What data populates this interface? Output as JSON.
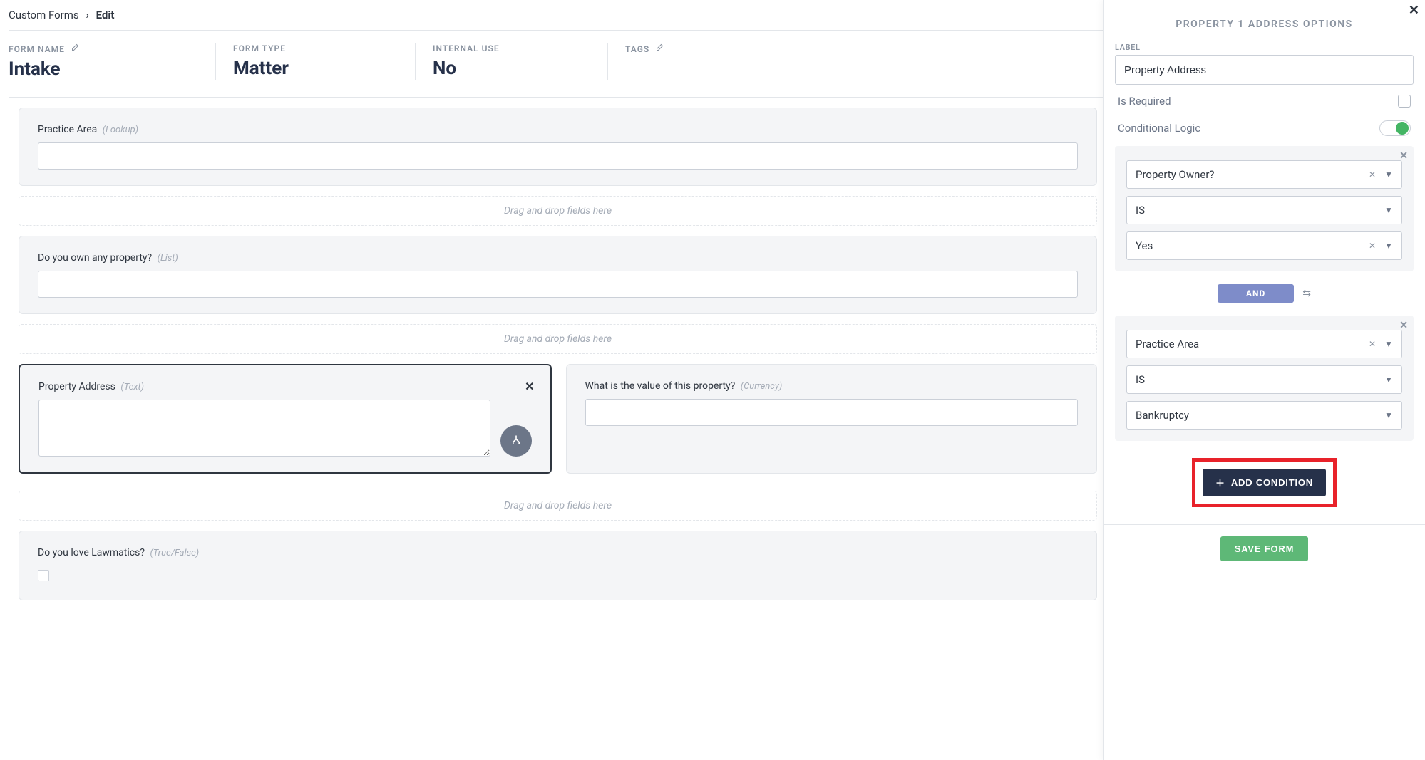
{
  "breadcrumb": {
    "root": "Custom Forms",
    "current": "Edit"
  },
  "meta": {
    "formName": {
      "label": "FORM NAME",
      "value": "Intake"
    },
    "formType": {
      "label": "FORM TYPE",
      "value": "Matter"
    },
    "internal": {
      "label": "INTERNAL USE",
      "value": "No"
    },
    "tags": {
      "label": "TAGS"
    }
  },
  "dropText": "Drag and drop fields here",
  "fields": {
    "practiceArea": {
      "label": "Practice Area",
      "hint": "(Lookup)"
    },
    "ownProperty": {
      "label": "Do you own any property?",
      "hint": "(List)"
    },
    "propertyAddress": {
      "label": "Property Address",
      "hint": "(Text)"
    },
    "propertyValue": {
      "label": "What is the value of this property?",
      "hint": "(Currency)"
    },
    "loveLawmatics": {
      "label": "Do you love Lawmatics?",
      "hint": "(True/False)"
    }
  },
  "sidebar": {
    "title": "PROPERTY 1 ADDRESS OPTIONS",
    "labelLabel": "LABEL",
    "labelValue": "Property Address",
    "isRequiredLabel": "Is Required",
    "condLogicLabel": "Conditional Logic",
    "cond1": {
      "field": "Property Owner?",
      "op": "IS",
      "value": "Yes"
    },
    "andLabel": "AND",
    "cond2": {
      "field": "Practice Area",
      "op": "IS",
      "value": "Bankruptcy"
    },
    "addCondition": "ADD CONDITION",
    "saveForm": "SAVE FORM"
  }
}
